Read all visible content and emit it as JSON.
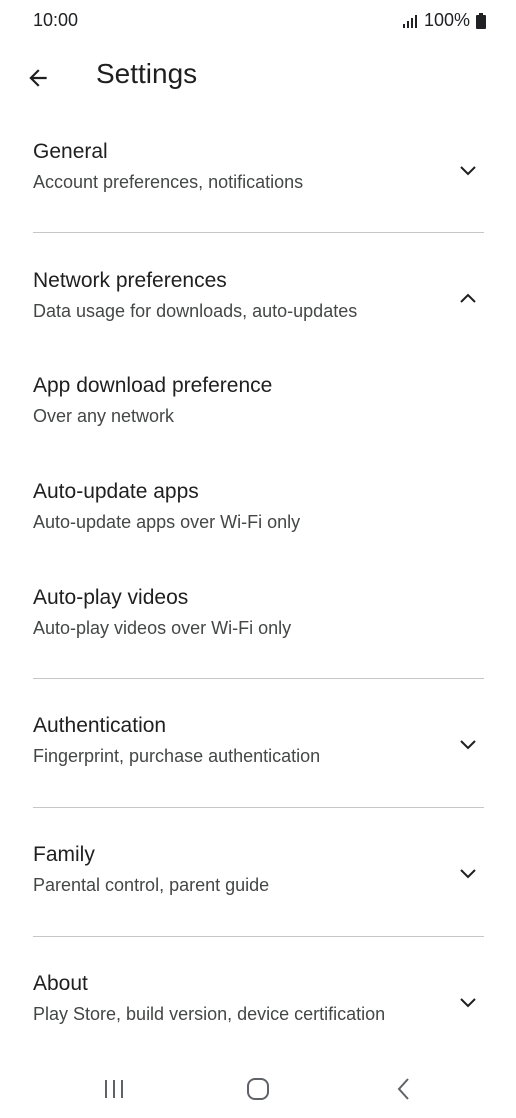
{
  "status_bar": {
    "time": "10:00",
    "battery_text": "100%"
  },
  "header": {
    "title": "Settings",
    "back_icon": "arrow-left-icon"
  },
  "sections": [
    {
      "title": "General",
      "subtitle": "Account preferences, notifications",
      "chevron": "chevron-down-icon"
    },
    {
      "title": "Network preferences",
      "subtitle": "Data usage for downloads, auto-updates",
      "chevron": "chevron-up-icon"
    },
    {
      "title": "App download preference",
      "subtitle": "Over any network"
    },
    {
      "title": "Auto-update apps",
      "subtitle": "Auto-update apps over Wi-Fi only"
    },
    {
      "title": "Auto-play videos",
      "subtitle": "Auto-play videos over Wi-Fi only"
    },
    {
      "title": "Authentication",
      "subtitle": "Fingerprint, purchase authentication",
      "chevron": "chevron-down-icon"
    },
    {
      "title": "Family",
      "subtitle": "Parental control, parent guide",
      "chevron": "chevron-down-icon"
    },
    {
      "title": "About",
      "subtitle": "Play Store, build version, device certification",
      "chevron": "chevron-down-icon"
    }
  ],
  "nav_bar": {
    "recents_icon": "recents-icon",
    "home_icon": "home-icon",
    "back_icon": "back-icon"
  },
  "colors": {
    "text_primary": "#1f1f1f",
    "text_secondary": "#444746",
    "divider": "#c4c7c5"
  }
}
